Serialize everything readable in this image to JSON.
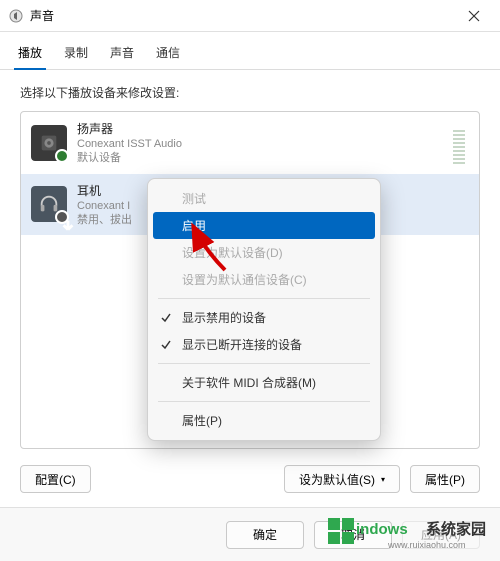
{
  "window": {
    "title": "声音"
  },
  "tabs": {
    "t0": "播放",
    "t1": "录制",
    "t2": "声音",
    "t3": "通信"
  },
  "instruction": "选择以下播放设备来修改设置:",
  "devices": [
    {
      "name": "扬声器",
      "desc1": "Conexant ISST Audio",
      "desc2": "默认设备"
    },
    {
      "name": "耳机",
      "desc1": "Conexant I",
      "desc2": "禁用、拔出"
    }
  ],
  "menu": {
    "test": "测试",
    "enable": "启用",
    "setdef": "设置为默认设备(D)",
    "setcomm": "设置为默认通信设备(C)",
    "showdis": "显示禁用的设备",
    "showdc": "显示已断开连接的设备",
    "about": "关于软件 MIDI 合成器(M)",
    "props": "属性(P)"
  },
  "buttons": {
    "configure": "配置(C)",
    "setdefault": "设为默认值(S)",
    "properties": "属性(P)",
    "ok": "确定",
    "cancel": "取消",
    "apply": "应用(A)"
  },
  "watermark": {
    "brand": "indows",
    "suffix": "系统家园",
    "url": "www.ruixiaohu.com"
  }
}
